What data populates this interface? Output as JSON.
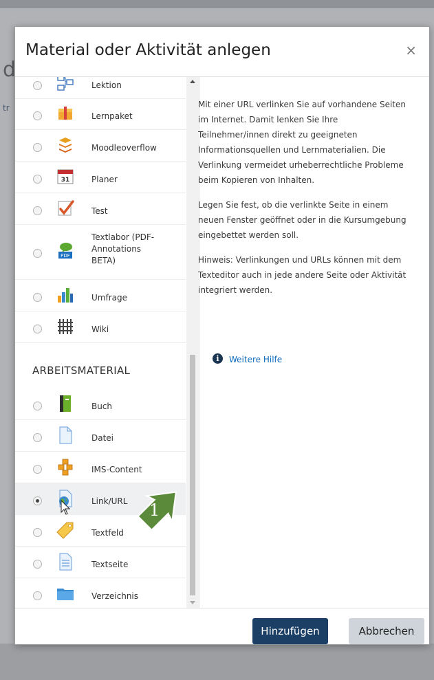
{
  "dialog": {
    "title": "Material oder Aktivität anlegen",
    "close_symbol": "×"
  },
  "background": {
    "fragment_large": "d",
    "fragment_small": "tr"
  },
  "activities": [
    {
      "label": "Lektion",
      "icon": "lesson-icon",
      "selected": false
    },
    {
      "label": "Lernpaket",
      "icon": "package-icon",
      "selected": false
    },
    {
      "label": "Moodleoverflow",
      "icon": "moodleoverflow-icon",
      "selected": false
    },
    {
      "label": "Planer",
      "icon": "calendar-icon",
      "calendar_day": "31",
      "selected": false
    },
    {
      "label": "Test",
      "icon": "quiz-icon",
      "selected": false
    },
    {
      "label": "Textlabor (PDF-Annotations BETA)",
      "icon": "pdf-annotation-icon",
      "selected": false
    },
    {
      "label": "Umfrage",
      "icon": "survey-chart-icon",
      "selected": false
    },
    {
      "label": "Wiki",
      "icon": "wiki-icon",
      "selected": false
    }
  ],
  "section_heading": "ARBEITSMATERIAL",
  "resources": [
    {
      "label": "Buch",
      "icon": "book-icon",
      "selected": false
    },
    {
      "label": "Datei",
      "icon": "file-icon",
      "selected": false
    },
    {
      "label": "IMS-Content",
      "icon": "ims-content-icon",
      "selected": false
    },
    {
      "label": "Link/URL",
      "icon": "globe-link-icon",
      "selected": true
    },
    {
      "label": "Textfeld",
      "icon": "label-tag-icon",
      "selected": false
    },
    {
      "label": "Textseite",
      "icon": "page-icon",
      "selected": false
    },
    {
      "label": "Verzeichnis",
      "icon": "folder-icon",
      "selected": false
    }
  ],
  "help": {
    "paragraph1": "Mit einer URL verlinken Sie auf vorhandene Seiten im Internet. Damit lenken Sie Ihre Teilnehmer/innen direkt zu geeigneten Informationsquellen und Lernmaterialien. Die Verlinkung vermeidet urheberrechtliche Probleme beim Kopieren von Inhalten.",
    "paragraph2": "Legen Sie fest, ob die verlinkte Seite in einem neuen Fenster geöffnet oder in die Kursumgebung eingebettet werden soll.",
    "paragraph3": "Hinweis: Verlinkungen und URLs können mit dem Texteditor auch in jede andere Seite oder Aktivität integriert werden.",
    "more_help": "Weitere Hilfe",
    "info_symbol": "i"
  },
  "footer": {
    "add_label": "Hinzufügen",
    "cancel_label": "Abbrechen"
  },
  "annotation": {
    "step_number": "1",
    "color": "#5a8a3a"
  },
  "colors": {
    "primary": "#1c3f66",
    "link": "#0f6cbf",
    "secondary_button": "#ced4da"
  }
}
